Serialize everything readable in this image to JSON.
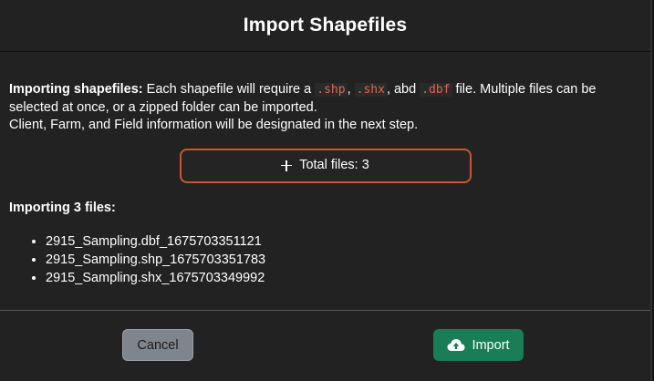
{
  "header": {
    "title": "Import Shapefiles"
  },
  "description": {
    "bold_lead": "Importing shapefiles:",
    "text_1": " Each shapefile will require a ",
    "ext_shp": ".shp",
    "sep_1": ", ",
    "ext_shx": ".shx",
    "sep_2": ", abd ",
    "ext_dbf": ".dbf",
    "text_2": " file. Multiple files can be selected at once, or a zipped folder can be imported.",
    "line_2": "Client, Farm, and Field information will be designated in the next step."
  },
  "upload": {
    "label": "Total files: 3",
    "icon": "plus-icon"
  },
  "importing": {
    "heading": "Importing 3 files:",
    "files": [
      "2915_Sampling.dbf_1675703351121",
      "2915_Sampling.shp_1675703351783",
      "2915_Sampling.shx_1675703349992"
    ]
  },
  "footer": {
    "cancel_label": "Cancel",
    "import_label": "Import",
    "import_icon": "cloud-upload-icon"
  },
  "colors": {
    "accent": "#c9572a",
    "import_green": "#197d55",
    "cancel_gray": "#7f858d",
    "background": "#222222"
  }
}
